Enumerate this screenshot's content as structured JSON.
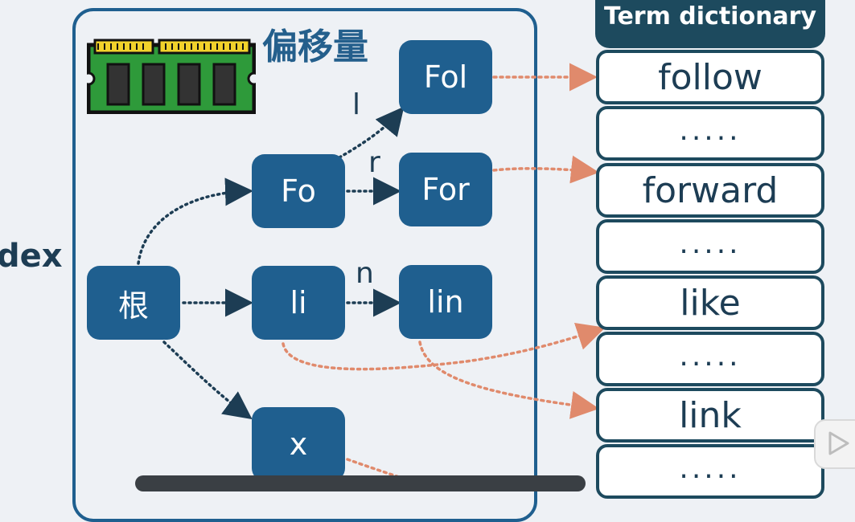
{
  "left_label": "dex",
  "offset_label": "偏移量",
  "nodes": {
    "root": "根",
    "fo": "Fo",
    "fol": "Fol",
    "for": "For",
    "li": "li",
    "lin": "lin",
    "x": "x"
  },
  "edge_labels": {
    "l": "l",
    "r": "r",
    "n": "n"
  },
  "dictionary": {
    "header": "Term dictionary",
    "entries": [
      "follow",
      ".....",
      "forward",
      ".....",
      "like",
      ".....",
      "link",
      "....."
    ]
  },
  "colors": {
    "node": "#1f5f8f",
    "dict_border": "#1d4a5e",
    "trie_arrow": "#1d3d54",
    "offset_arrow": "#e08a6c"
  },
  "icons": [
    "memory-chip-icon",
    "play-icon"
  ]
}
